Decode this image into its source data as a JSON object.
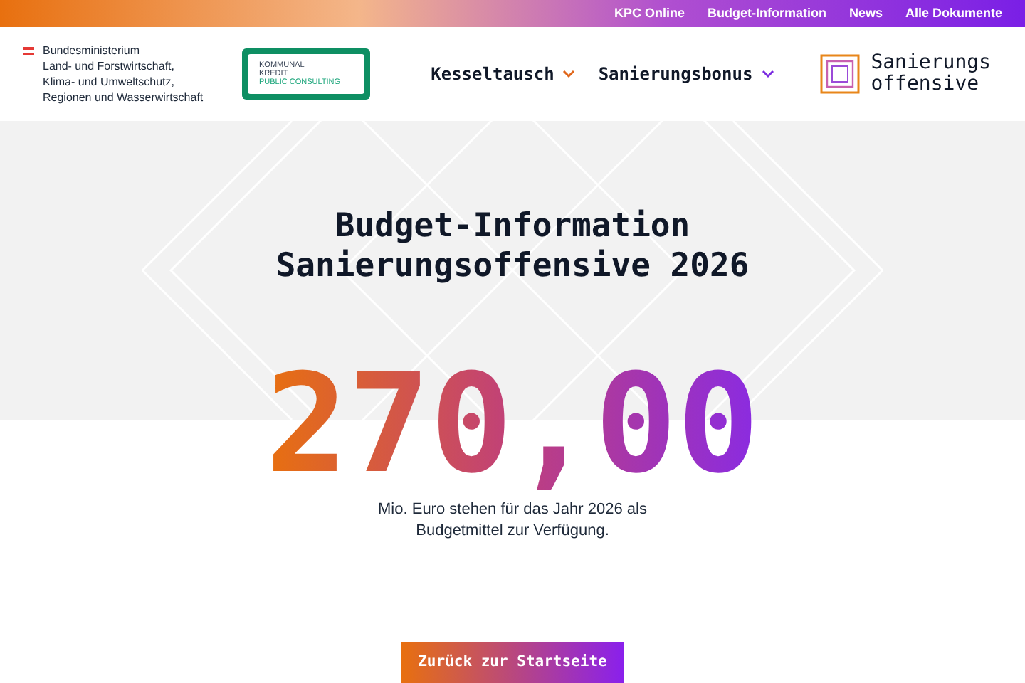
{
  "top_links": [
    "KPC Online",
    "Budget-Information",
    "News",
    "Alle Dokumente"
  ],
  "ministry": {
    "lines": [
      "Bundesministerium",
      "Land- und Forstwirtschaft,",
      "Klima- und Umweltschutz,",
      "Regionen und Wasserwirtschaft"
    ]
  },
  "partner_logo": {
    "lines": [
      "KOMMUNAL",
      "KREDIT",
      "PUBLIC CONSULTING"
    ]
  },
  "nav": [
    {
      "label": "Kesseltausch",
      "color": "#e0661a"
    },
    {
      "label": "Sanierungsbonus",
      "color": "#7a2be0"
    }
  ],
  "brand": {
    "lines": [
      "Sanierungs",
      "offensive"
    ]
  },
  "hero": {
    "title_lines": [
      "Budget-Information",
      "Sanierungsoffensive 2026"
    ],
    "amount": "270,00",
    "caption": "Mio. Euro stehen für das Jahr 2026 als Budgetmittel zur Verfügung."
  },
  "button": "Zurück zur Startseite"
}
